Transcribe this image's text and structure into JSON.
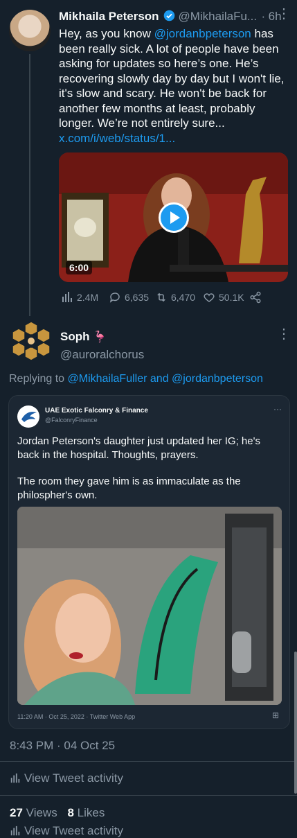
{
  "tweet": {
    "author_name": "Mikhaila Peterson",
    "author_handle": "@MikhailaFu...",
    "time_sep": "·",
    "time": "6h",
    "text_before": "Hey, as you know ",
    "mention": "@jordanbpeterson",
    "text_after": " has been really sick. A lot of people have been asking for updates so here’s one. He’s recovering slowly day by day but I won't lie, it's slow and scary. He won't be back for another few months at least, probably longer. We’re not entirely sure...",
    "link": "x.com/i/web/status/1...",
    "video_duration": "6:00",
    "stats": {
      "views": "2.4M",
      "replies": "6,635",
      "retweets": "6,470",
      "likes": "50.1K"
    }
  },
  "reply": {
    "author_name": "Soph",
    "author_emoji": "🦩",
    "author_handle": "@auroralchorus",
    "replying_to_label": "Replying to",
    "replying_to_user1": "@MikhailaFuller",
    "and_label": "and",
    "replying_to_user2": "@jordanbpeterson",
    "embedded_tweet": {
      "author_name": "UAE Exotic Falconry & Finance",
      "author_handle": "@FalconryFinance",
      "text_line1": "Jordan Peterson's daughter just updated her IG; he's back in the hospital. Thoughts, prayers.",
      "text_line2": "The room they gave him is as immaculate as the philospher's own.",
      "footer": "11:20 AM · Oct 25, 2022 · Twitter Web App"
    },
    "timestamp": "8:43 PM · 04 Oct 25",
    "activity_label": "View Tweet activity",
    "views_count": "27",
    "views_label": "Views",
    "likes_count": "8",
    "likes_label": "Likes",
    "cutoff_label": "View Tweet activity"
  },
  "colors": {
    "background": "#15202b",
    "accent": "#1d9bf0",
    "muted": "#8b98a5"
  }
}
